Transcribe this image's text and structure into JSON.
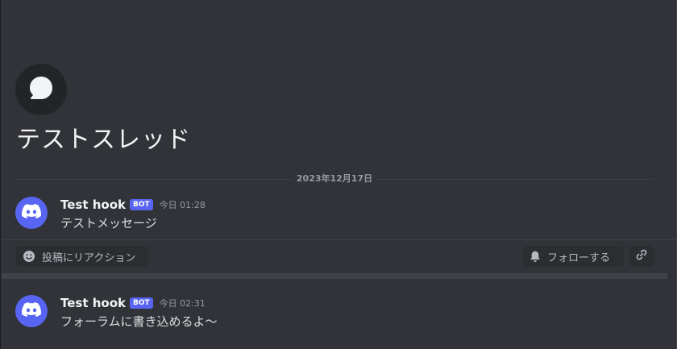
{
  "thread": {
    "icon": "chat-bubble-icon",
    "title": "テストスレッド"
  },
  "divider": {
    "date": "2023年12月17日"
  },
  "messages": [
    {
      "author": "Test hook",
      "tag": "BOT",
      "timestamp": "今日 01:28",
      "content": "テストメッセージ",
      "avatar_icon": "discord-logo-icon"
    },
    {
      "author": "Test hook",
      "tag": "BOT",
      "timestamp": "今日 02:31",
      "content": "フォーラムに書き込めるよ〜",
      "avatar_icon": "discord-logo-icon"
    }
  ],
  "actions": {
    "reaction_label": "投稿にリアクション",
    "reaction_icon": "smiley-icon",
    "follow_label": "フォローする",
    "follow_icon": "bell-icon",
    "link_icon": "link-icon"
  },
  "colors": {
    "background": "#313338",
    "accent": "#5865f2",
    "pill_bg": "#2b2d31",
    "separator": "#404249"
  }
}
